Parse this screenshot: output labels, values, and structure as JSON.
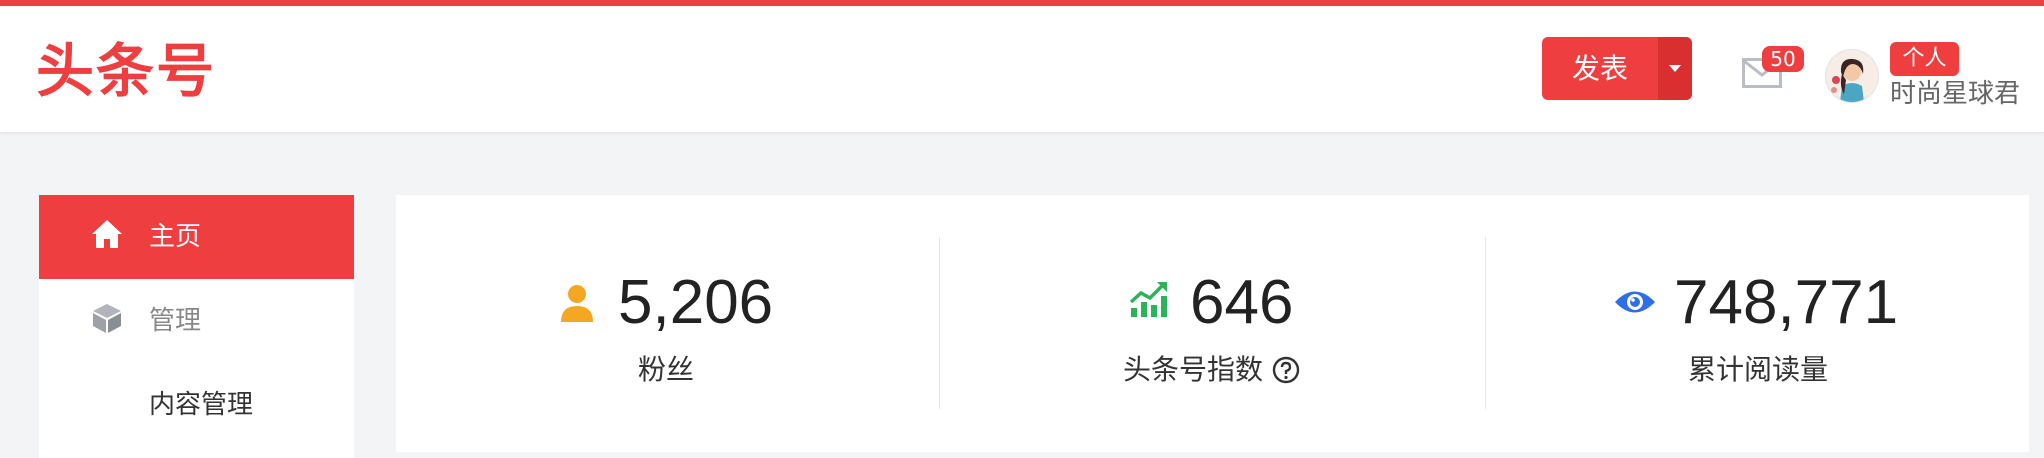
{
  "header": {
    "logo": "头条号",
    "publish_label": "发表",
    "mail_count": "50",
    "role_badge": "个人",
    "username": "时尚星球君"
  },
  "sidebar": {
    "items": [
      {
        "label": "主页",
        "icon": "home-icon",
        "active": true
      },
      {
        "label": "管理",
        "icon": "cube-icon",
        "active": false
      },
      {
        "label": "内容管理",
        "active": false
      }
    ]
  },
  "stats": [
    {
      "value": "5,206",
      "label": "粉丝",
      "icon": "user-icon",
      "color": "#f5a623"
    },
    {
      "value": "646",
      "label": "头条号指数",
      "icon": "trend-chart-icon",
      "color": "#2bb35a",
      "help": true
    },
    {
      "value": "748,771",
      "label": "累计阅读量",
      "icon": "eye-icon",
      "color": "#2f6ee6"
    }
  ],
  "colors": {
    "accent": "#ee3e40",
    "accent_dark": "#d92f31",
    "background": "#f3f4f6"
  }
}
